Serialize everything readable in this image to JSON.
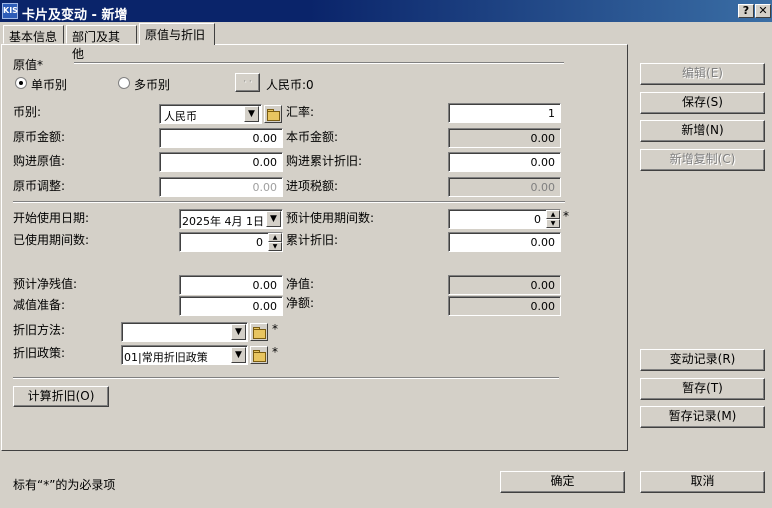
{
  "window": {
    "app_icon_text": "KIS",
    "title": "卡片及变动 - 新增",
    "help_btn": "?",
    "close_btn": "✕"
  },
  "tabs": [
    "基本信息",
    "部门及其他",
    "原值与折旧"
  ],
  "original_value": {
    "section_label": "原值*",
    "single_currency": "单币别",
    "multi_currency": "多币别",
    "small_btn": "· ·",
    "rmb_label": "人民币:0",
    "currency_label": "币别:",
    "currency_value": "人民币",
    "rate_label": "汇率:",
    "rate_value": "1",
    "orig_amount_label": "原币金额:",
    "orig_amount_value": "0.00",
    "local_amount_label": "本币金额:",
    "local_amount_value": "0.00",
    "purchase_value_label": "购进原值:",
    "purchase_value": "0.00",
    "purchase_accum_label": "购进累计折旧:",
    "purchase_accum_value": "0.00",
    "orig_adjust_label": "原币调整:",
    "orig_adjust_value": "0.00",
    "input_tax_label": "进项税额:",
    "input_tax_value": "0.00"
  },
  "depreciation": {
    "start_date_label": "开始使用日期:",
    "start_date_value": "2025年 4月 1日",
    "expected_periods_label": "预计使用期间数:",
    "expected_periods_value": "0",
    "used_periods_label": "已使用期间数:",
    "used_periods_value": "0",
    "accum_dep_label": "累计折旧:",
    "accum_dep_value": "0.00",
    "residual_label": "预计净残值:",
    "residual_value": "0.00",
    "net_value_label": "净值:",
    "net_value": "0.00",
    "impairment_label": "减值准备:",
    "impairment_value": "0.00",
    "net_amount_label": "净额:",
    "net_amount_value": "0.00",
    "method_label": "折旧方法:",
    "method_value": "",
    "policy_label": "折旧政策:",
    "policy_value": "01|常用折旧政策",
    "required_mark": "*",
    "calc_btn": "计算折旧(O)"
  },
  "side_buttons": {
    "edit": "编辑(E)",
    "save": "保存(S)",
    "add": "新增(N)",
    "add_copy": "新增复制(C)",
    "change_log": "变动记录(R)",
    "temp_save": "暂存(T)",
    "temp_log": "暂存记录(M)"
  },
  "footer": {
    "note": "标有“*”的为必录项",
    "ok": "确定",
    "cancel": "取消"
  }
}
